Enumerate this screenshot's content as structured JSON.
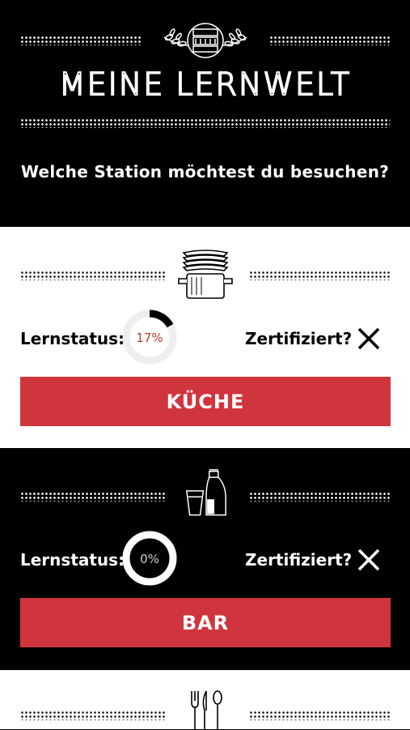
{
  "header": {
    "logo_text": "DORTMUND",
    "title": "MEINE LERNWELT",
    "subtitle": "Welche Station möchtest du besuchen?"
  },
  "stations": [
    {
      "icon": "pot-with-plates-icon",
      "status_label": "Lernstatus:",
      "progress_text": "17%",
      "progress": 0.17,
      "cert_label": "Zertifiziert?",
      "cert_icon": "close-icon",
      "button_label": "KÜCHE"
    },
    {
      "icon": "glass-and-carafe-icon",
      "status_label": "Lernstatus:",
      "progress_text": "0%",
      "progress": 0,
      "cert_label": "Zertifiziert?",
      "cert_icon": "close-icon",
      "button_label": "BAR"
    },
    {
      "icon": "cutlery-icon"
    }
  ],
  "colors": {
    "accent": "#d0353e",
    "dark": "#000000",
    "light": "#ffffff",
    "progress_text": "#c0392b"
  }
}
